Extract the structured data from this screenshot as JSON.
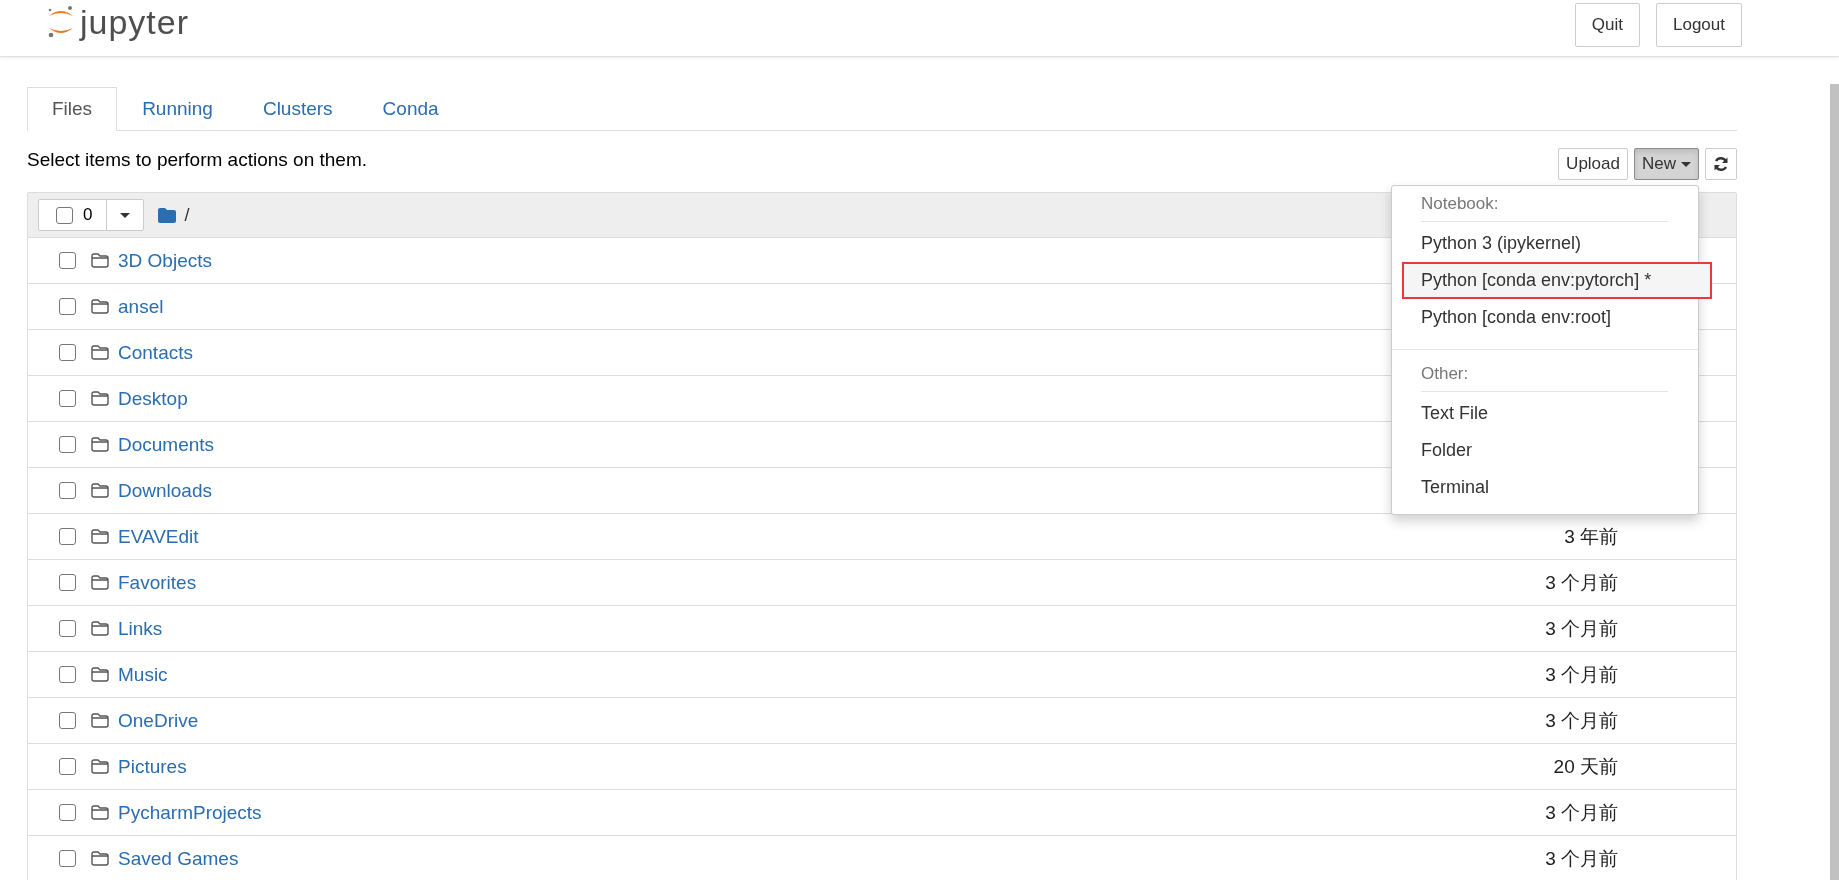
{
  "header": {
    "logo_text": "jupyter",
    "buttons": [
      "Quit",
      "Logout"
    ]
  },
  "tabs": [
    {
      "label": "Files",
      "selected": true
    },
    {
      "label": "Running",
      "selected": false
    },
    {
      "label": "Clusters",
      "selected": false
    },
    {
      "label": "Conda",
      "selected": false
    }
  ],
  "instruction": "Select items to perform actions on them.",
  "toolbar": {
    "upload": "Upload",
    "new_button": {
      "label": "New",
      "open": true
    }
  },
  "new_menu": [
    {
      "header": "Notebook:",
      "items": [
        {
          "label": "Python 3 (ipykernel)",
          "selected": false
        },
        {
          "label": "Python [conda env:pytorch] *",
          "selected": true
        },
        {
          "label": "Python [conda env:root]",
          "selected": false
        }
      ]
    },
    {
      "header": "Other:",
      "items": [
        {
          "label": "Text File",
          "selected": false
        },
        {
          "label": "Folder",
          "selected": false
        },
        {
          "label": "Terminal",
          "selected": false
        }
      ]
    }
  ],
  "list_header": {
    "selected_count": "0",
    "all_checked": false,
    "path": "/"
  },
  "rows": [
    {
      "name": "3D Objects",
      "checked": false
    },
    {
      "name": "ansel",
      "checked": false
    },
    {
      "name": "Contacts",
      "checked": false
    },
    {
      "name": "Desktop",
      "checked": false
    },
    {
      "name": "Documents",
      "checked": false
    },
    {
      "name": "Downloads",
      "checked": false
    },
    {
      "name": "EVAVEdit",
      "modified": "3 年前",
      "checked": false
    },
    {
      "name": "Favorites",
      "modified": "3 个月前",
      "checked": false
    },
    {
      "name": "Links",
      "modified": "3 个月前",
      "checked": false
    },
    {
      "name": "Music",
      "modified": "3 个月前",
      "checked": false
    },
    {
      "name": "OneDrive",
      "modified": "3 个月前",
      "checked": false
    },
    {
      "name": "Pictures",
      "modified": "20 天前",
      "checked": false
    },
    {
      "name": "PycharmProjects",
      "modified": "3 个月前",
      "checked": false
    },
    {
      "name": "Saved Games",
      "modified": "3 个月前",
      "checked": false
    }
  ]
}
